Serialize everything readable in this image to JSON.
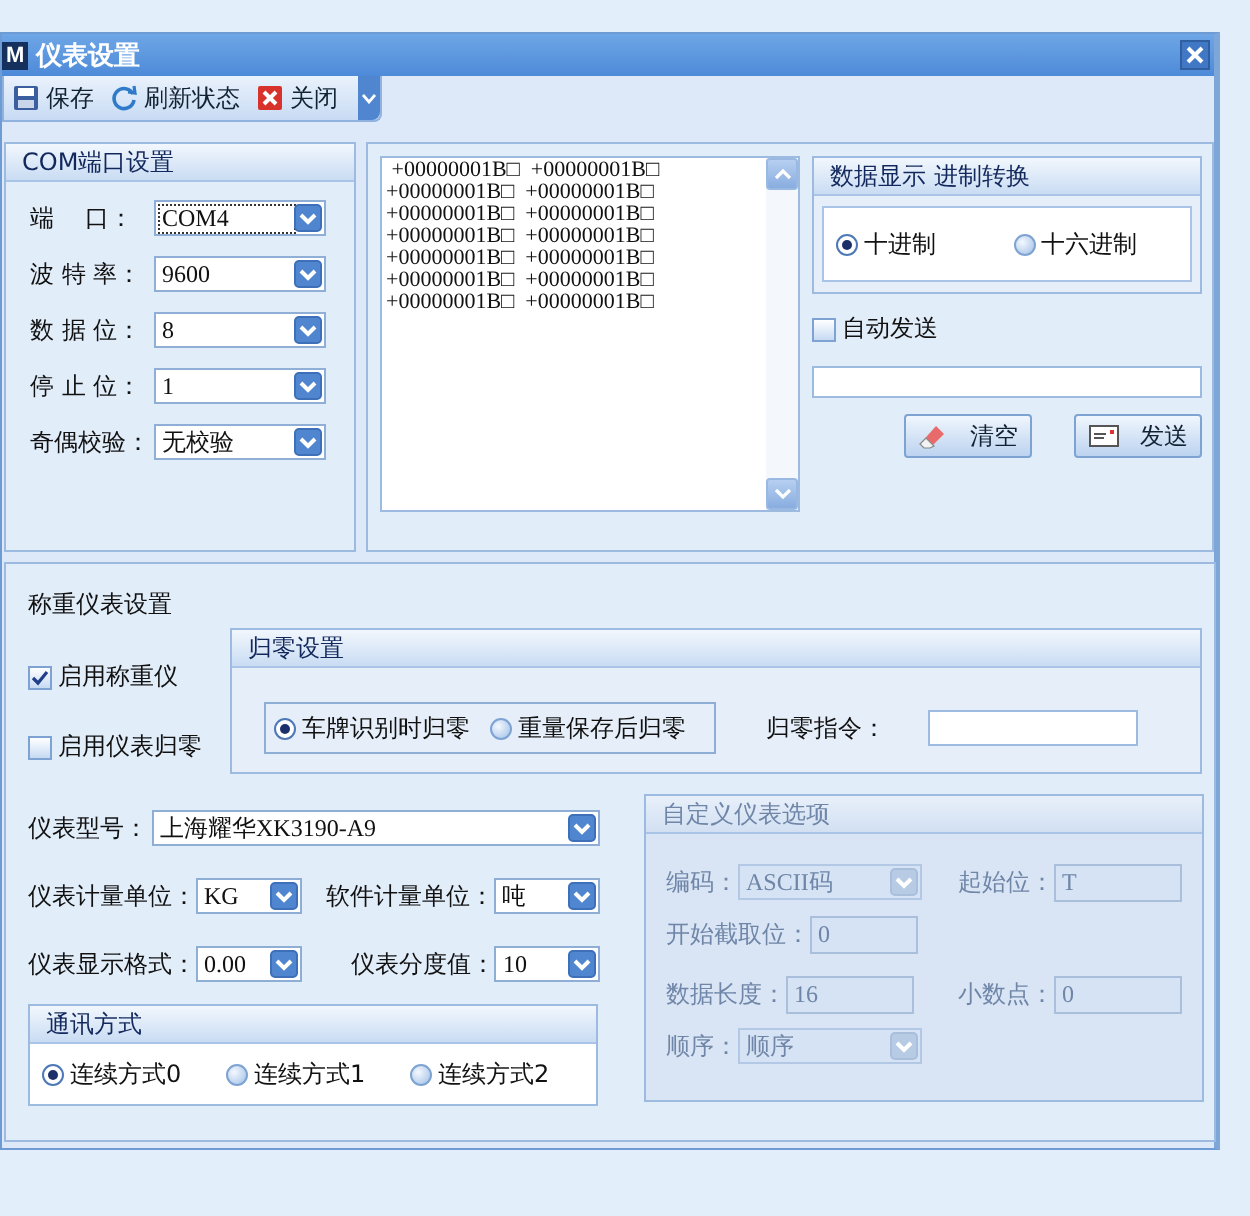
{
  "window": {
    "icon": "M",
    "title": "仪表设置"
  },
  "toolbar": [
    {
      "kind": "save",
      "label": "保存"
    },
    {
      "kind": "refresh",
      "label": "刷新状态"
    },
    {
      "kind": "close",
      "label": "关闭"
    }
  ],
  "com_settings": {
    "title": "COM端口设置",
    "fields": [
      {
        "label": "端    口：",
        "value": "COM4",
        "focused": true
      },
      {
        "label": "波 特 率：",
        "value": "9600",
        "focused": false
      },
      {
        "label": "数 据 位：",
        "value": "8",
        "focused": false
      },
      {
        "label": "停 止 位：",
        "value": "1",
        "focused": false
      },
      {
        "label": "奇偶校验：",
        "value": "无校验",
        "focused": false
      }
    ]
  },
  "log_lines": [
    " +00000001B□  +00000001B□",
    "+00000001B□  +00000001B□",
    "+00000001B□  +00000001B□",
    "+00000001B□  +00000001B□",
    "+00000001B□  +00000001B□",
    "+00000001B□  +00000001B□",
    "+00000001B□  +00000001B□"
  ],
  "radix_group": {
    "title": "数据显示 进制转换",
    "options": [
      {
        "label": "十进制",
        "selected": true
      },
      {
        "label": "十六进制",
        "selected": false
      }
    ]
  },
  "auto_send": {
    "label": "自动发送",
    "checked": false
  },
  "buttons": [
    {
      "kind": "clear",
      "label": "清空"
    },
    {
      "kind": "send",
      "label": "发送"
    }
  ],
  "scale": {
    "title": "称重仪表设置",
    "checkboxes": [
      {
        "label": "启用称重仪",
        "checked": true
      },
      {
        "label": "启用仪表归零",
        "checked": false
      }
    ],
    "zero_group": {
      "title": "归零设置",
      "options": [
        {
          "label": "车牌识别时归零",
          "selected": true
        },
        {
          "label": "重量保存后归零",
          "selected": false
        }
      ],
      "command_label": "归零指令："
    },
    "model": {
      "label": "仪表型号：",
      "value": "上海耀华XK3190-A9"
    },
    "unit_row": [
      {
        "label": "仪表计量单位：",
        "value": "KG"
      },
      {
        "label": "软件计量单位：",
        "value": "吨"
      }
    ],
    "format_row": [
      {
        "label": "仪表显示格式：",
        "value": "0.00"
      },
      {
        "label": "仪表分度值：",
        "value": "10"
      }
    ],
    "comm_group": {
      "title": "通讯方式",
      "options": [
        {
          "label": "连续方式0",
          "selected": true
        },
        {
          "label": "连续方式1",
          "selected": false
        },
        {
          "label": "连续方式2",
          "selected": false
        }
      ]
    },
    "custom_group": {
      "title": "自定义仪表选项",
      "disabled": true,
      "rows": [
        [
          {
            "kind": "combo",
            "label": "编码：",
            "value": "ASCII码"
          },
          {
            "kind": "text",
            "label": "起始位：",
            "value": "T"
          }
        ],
        [
          {
            "kind": "text",
            "label": "开始截取位：",
            "value": "0"
          }
        ],
        [
          {
            "kind": "text",
            "label": "数据长度：",
            "value": "16"
          },
          {
            "kind": "text",
            "label": "小数点：",
            "value": "0"
          }
        ],
        [
          {
            "kind": "combo",
            "label": "顺序：",
            "value": "顺序"
          }
        ]
      ]
    }
  }
}
